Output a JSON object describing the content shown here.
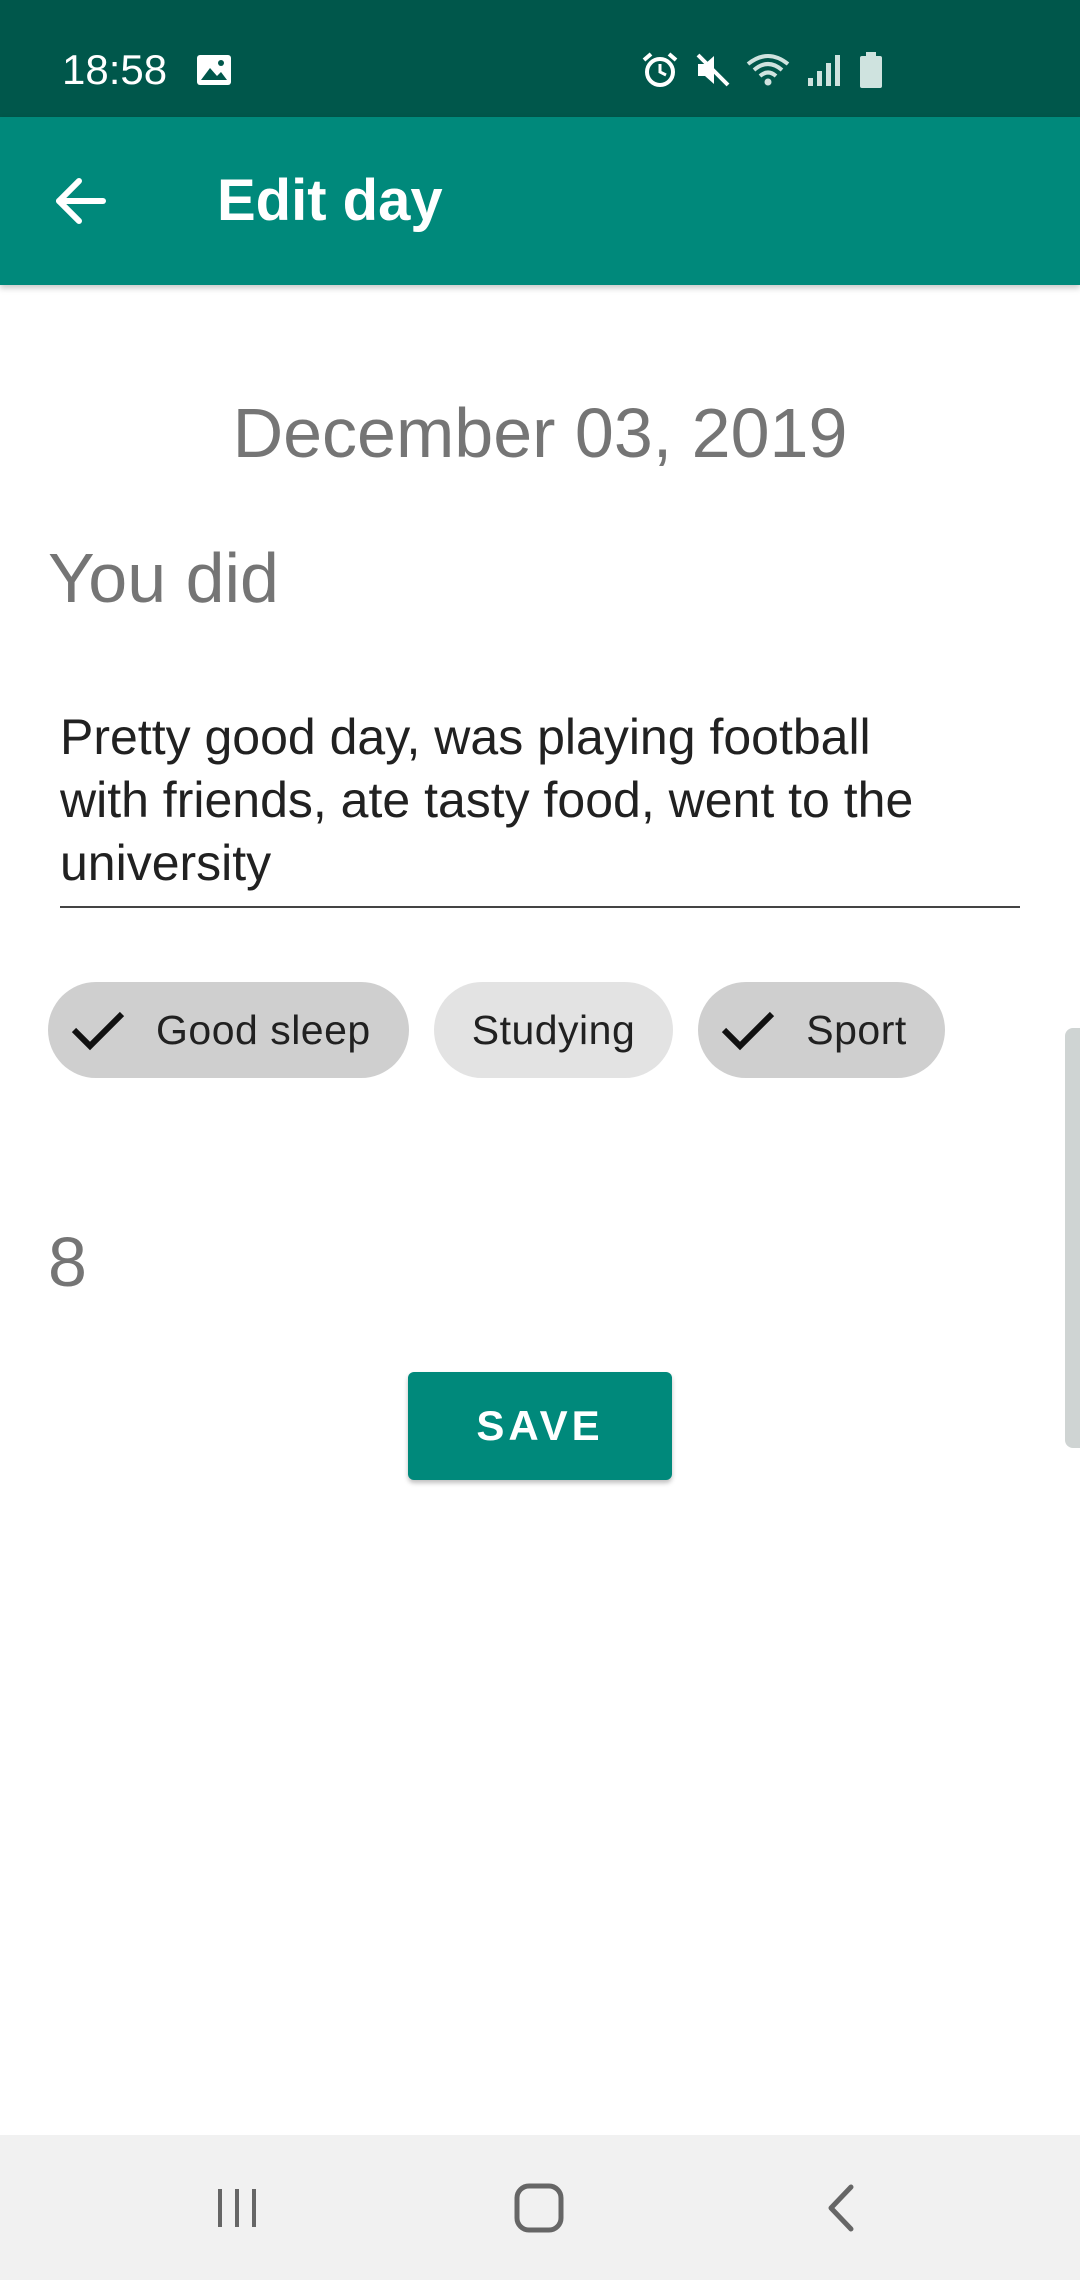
{
  "status_bar": {
    "time": "18:58",
    "icons": [
      "image-icon",
      "alarm-icon",
      "mute-icon",
      "wifi-icon",
      "signal-icon",
      "battery-icon"
    ]
  },
  "app_bar": {
    "title": "Edit day",
    "back_icon": "arrow-back-icon",
    "background": "#00897b"
  },
  "content": {
    "date": "December 03, 2019",
    "section_label": "You did",
    "notes": "Pretty good day, was playing football\nwith friends, ate tasty food, went to the\nuniversity",
    "chips": [
      {
        "label": "Good sleep",
        "selected": true
      },
      {
        "label": "Studying",
        "selected": false
      },
      {
        "label": "Sport",
        "selected": true
      }
    ],
    "rating": "8",
    "save_label": "SAVE"
  },
  "nav_bar": {
    "buttons": [
      "recent-apps-icon",
      "home-icon",
      "back-icon"
    ]
  }
}
